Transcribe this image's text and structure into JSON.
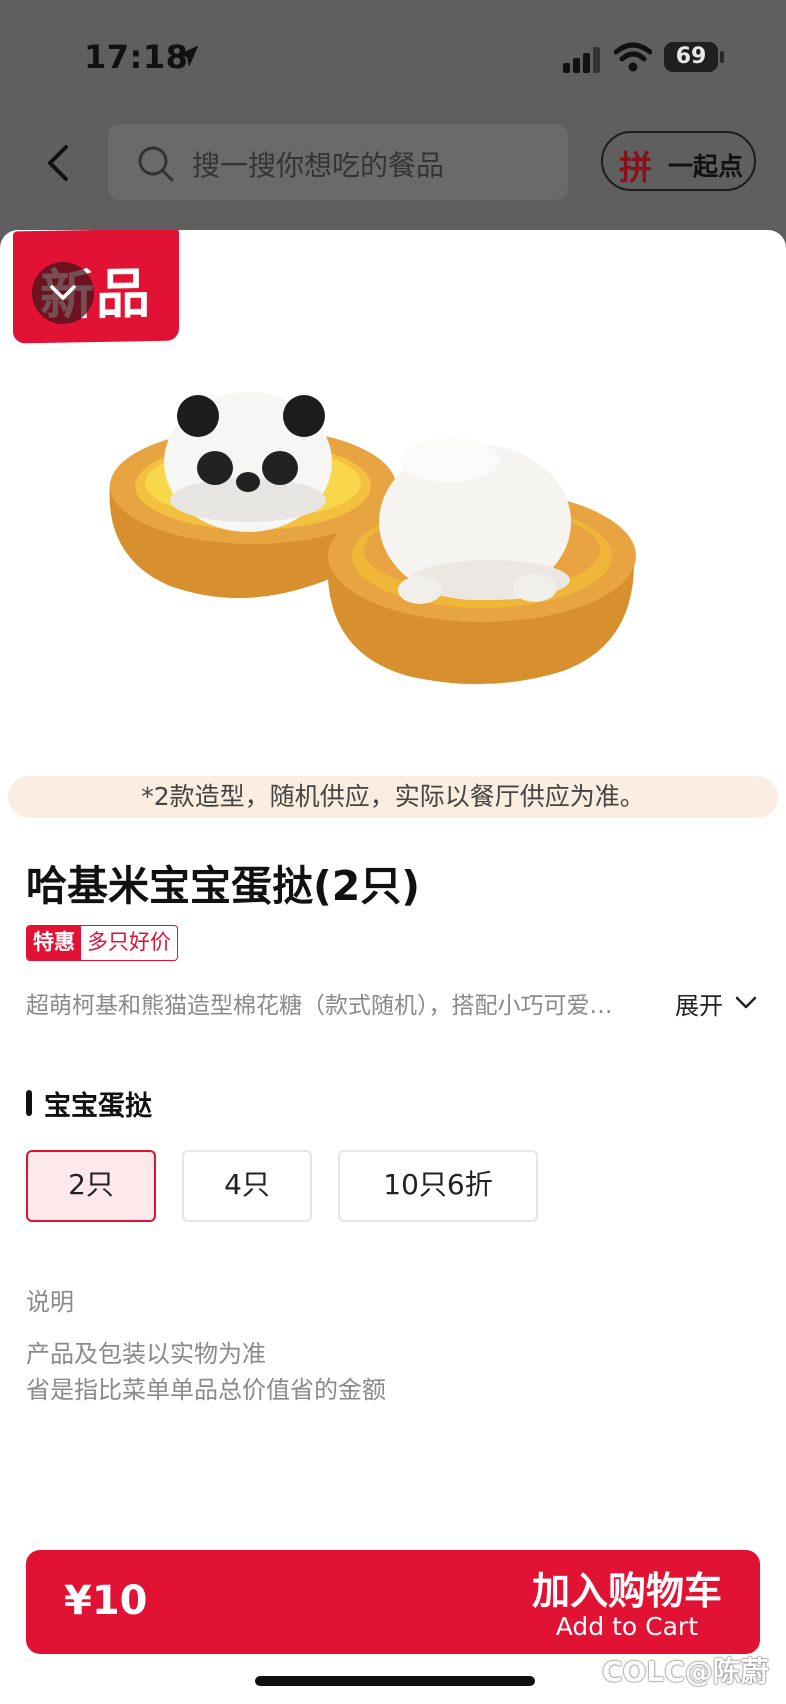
{
  "status": {
    "time": "17:18",
    "battery": "69"
  },
  "header": {
    "search_placeholder": "搜一搜你想吃的餐品",
    "group_icon_text": "拼",
    "group_label": "一起点"
  },
  "product": {
    "badge": "新品",
    "notice": "*2款造型，随机供应，实际以餐厅供应为准。",
    "name": "哈基米宝宝蛋挞(2只)",
    "tag_label": "特惠",
    "tag_text": "多只好价",
    "description": "超萌柯基和熊猫造型棉花糖（款式随机），搭配小巧可爱…",
    "expand_label": "展开"
  },
  "options": {
    "section_title": "宝宝蛋挞",
    "items": [
      {
        "label": "2只",
        "selected": true
      },
      {
        "label": "4只",
        "selected": false
      },
      {
        "label": "10只6折",
        "selected": false
      }
    ]
  },
  "notes": {
    "heading": "说明",
    "lines": [
      "产品及包装以实物为准",
      "省是指比菜单单品总价值省的金额"
    ]
  },
  "cart": {
    "price": "¥10",
    "add_cn": "加入购物车",
    "add_en": "Add to Cart"
  },
  "watermark": "COLC@陈蔚",
  "colors": {
    "brand_red": "#e11233",
    "notice_bg": "#fbeee0",
    "overlay": "#5f5f5f"
  }
}
